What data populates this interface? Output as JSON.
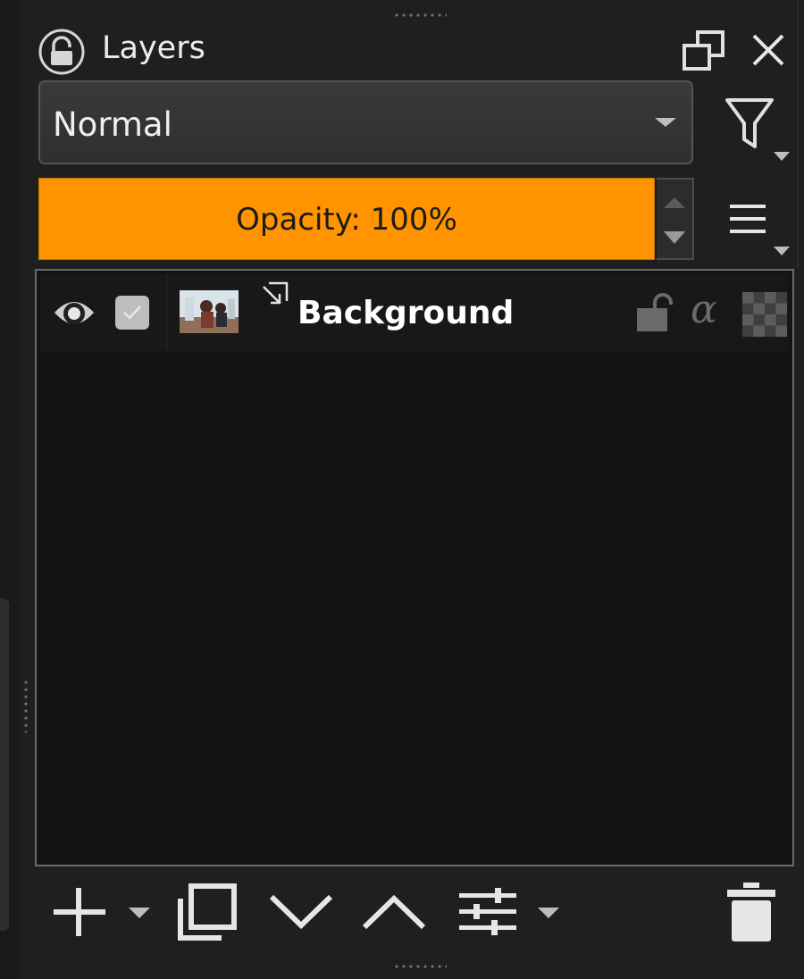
{
  "panel": {
    "title": "Layers"
  },
  "blend_mode": {
    "value": "Normal"
  },
  "opacity": {
    "label": "Opacity: 100%",
    "value_percent": 100,
    "accent_color": "#ff9400"
  },
  "layers": [
    {
      "name": "Background",
      "visible": true,
      "selected": true,
      "locked": false,
      "alpha_locked": false
    }
  ],
  "icons": {
    "header": [
      "lock-icon",
      "float-panel-icon",
      "close-icon"
    ],
    "side": [
      "filter-icon",
      "menu-icon"
    ],
    "row": [
      "eye-icon",
      "checkbox",
      "layer-thumbnail",
      "clip-arrow-icon",
      "lock-icon",
      "alpha-icon",
      "transparency-checker-icon"
    ],
    "toolbar": [
      "add-layer-icon",
      "duplicate-layer-icon",
      "move-down-icon",
      "move-up-icon",
      "layer-properties-icon",
      "delete-layer-icon"
    ]
  }
}
